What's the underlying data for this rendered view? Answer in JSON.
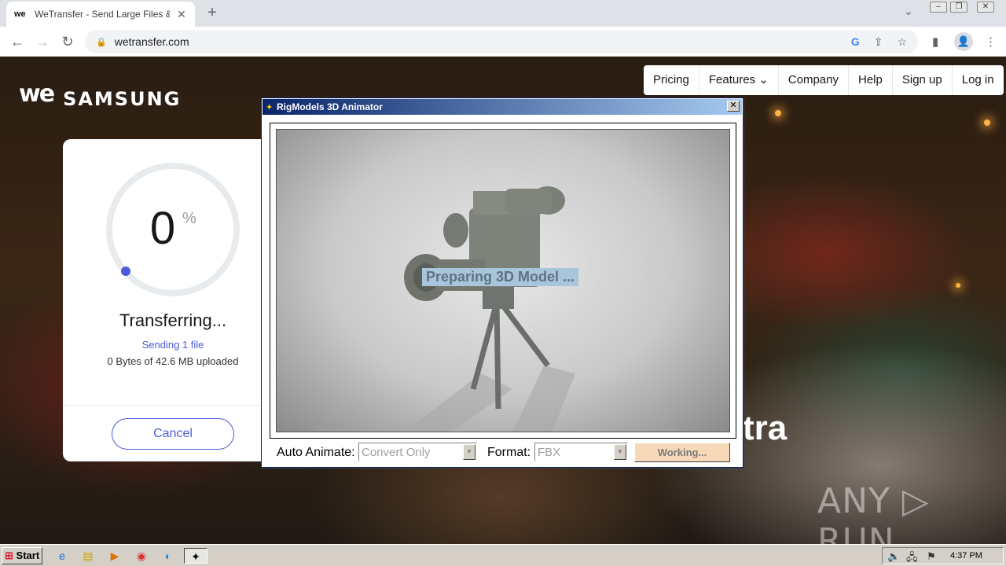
{
  "browser": {
    "tab": {
      "favicon": "we",
      "title": "WeTransfer - Send Large Files & Sha",
      "close": "✕"
    },
    "new_tab": "+",
    "url": "wetransfer.com",
    "window_controls": {
      "minimize": "–",
      "restore": "❐",
      "close": "✕"
    }
  },
  "brand": {
    "logo": "we",
    "sponsor": "SAMSUNG"
  },
  "nav": {
    "pricing": "Pricing",
    "features": "Features ⌄",
    "company": "Company",
    "help": "Help",
    "signup": "Sign up",
    "login": "Log in"
  },
  "transfer": {
    "percent": "0",
    "percent_sign": "%",
    "progress": 0,
    "status": "Transferring...",
    "sending": "Sending 1 file",
    "uploaded": "0 Bytes of 42.6 MB uploaded",
    "cancel": "Cancel"
  },
  "ad": {
    "text": "tra"
  },
  "watermark": "ANY ▷ RUN",
  "dialog": {
    "title": "RigModels 3D Animator",
    "close": "✕",
    "overlay_text": "Preparing 3D Model ...",
    "auto_animate_label": "Auto Animate:",
    "auto_animate_value": "Convert Only",
    "format_label": "Format:",
    "format_value": "FBX",
    "working_button": "Working..."
  },
  "taskbar": {
    "start": "Start",
    "clock": "4:37 PM"
  },
  "colors": {
    "accent": "#4b5bdc",
    "dialog_title_start": "#0a246a",
    "dialog_title_end": "#a6caf0"
  }
}
